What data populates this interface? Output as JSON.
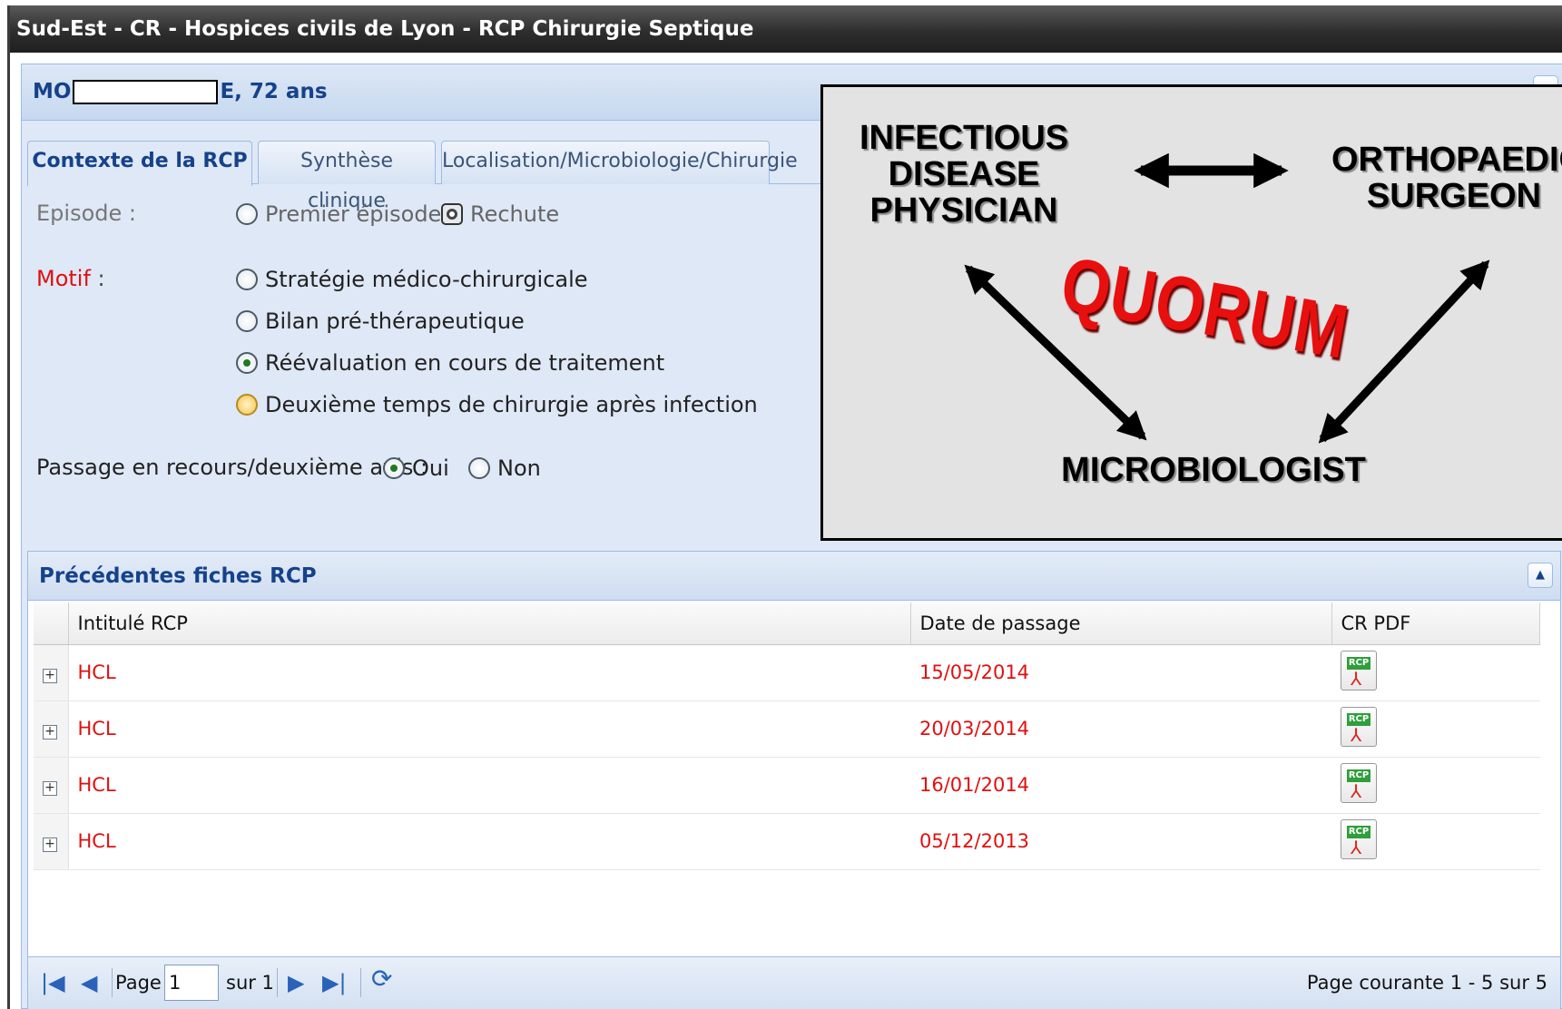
{
  "window": {
    "title": "Sud-Est - CR - Hospices civils de Lyon - RCP Chirurgie Septique"
  },
  "patient": {
    "name_prefix": "MO",
    "name_suffix": "E, 72 ans"
  },
  "tabs": [
    {
      "label": "Contexte de la RCP",
      "active": true
    },
    {
      "label": "Synthèse clinique",
      "active": false
    },
    {
      "label": "Localisation/Microbiologie/Chirurgie",
      "active": false
    }
  ],
  "form": {
    "episode": {
      "label": "Episode :",
      "options": [
        {
          "label": "Premier épisode",
          "checked": false
        },
        {
          "label": "Rechute",
          "checked": true
        }
      ]
    },
    "motif": {
      "label_red": "Motif",
      "label_rest": " :",
      "options": [
        {
          "label": "Stratégie médico-chirurgicale",
          "checked": false
        },
        {
          "label": "Bilan pré-thérapeutique",
          "checked": false
        },
        {
          "label": "Réévaluation en cours de traitement",
          "checked": true
        },
        {
          "label": "Deuxième temps de chirurgie après infection",
          "checked": false
        }
      ]
    },
    "recours": {
      "label": "Passage en recours/deuxième avis :",
      "options": [
        {
          "label": "Oui",
          "checked": true
        },
        {
          "label": "Non",
          "checked": false
        }
      ]
    }
  },
  "grid": {
    "title": "Précédentes fiches RCP",
    "columns": [
      "Intitulé RCP",
      "Date de passage",
      "CR PDF"
    ],
    "rows": [
      {
        "intitule": "HCL",
        "date": "15/05/2014",
        "pdf_icon": "rcp-pdf-icon"
      },
      {
        "intitule": "HCL",
        "date": "20/03/2014",
        "pdf_icon": "rcp-pdf-icon"
      },
      {
        "intitule": "HCL",
        "date": "16/01/2014",
        "pdf_icon": "rcp-pdf-icon"
      },
      {
        "intitule": "HCL",
        "date": "05/12/2013",
        "pdf_icon": "rcp-pdf-icon"
      }
    ],
    "pdf_tag": "RCP",
    "pager": {
      "page_label": "Page",
      "page_value": "1",
      "of_label": "sur 1",
      "summary": "Page courante 1 - 5 sur 5"
    }
  },
  "overlay": {
    "infectious": "INFECTIOUS DISEASE PHYSICIAN",
    "ortho": "ORTHOPAEDIC SURGEON",
    "micro": "MICROBIOLOGIST",
    "quorum": "QUORUM",
    "quorum_color": "#e80f0f"
  },
  "colors": {
    "accent": "#15428b",
    "required": "#e01010",
    "panel_bg": "#dfe8f6"
  }
}
